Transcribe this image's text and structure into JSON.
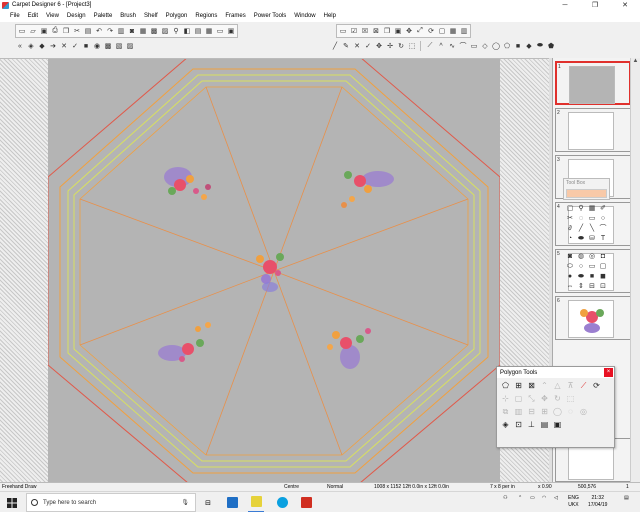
{
  "window": {
    "title": "Carpet Designer 6 - [Project3]",
    "controls": [
      "─",
      "❐",
      "✕"
    ]
  },
  "menu": [
    "File",
    "Edit",
    "View",
    "Design",
    "Palette",
    "Brush",
    "Shelf",
    "Polygon",
    "Regions",
    "Frames",
    "Power Tools",
    "Window",
    "Help"
  ],
  "toolbar": {
    "row1_icons": [
      "new-icon",
      "open-icon",
      "save-icon",
      "print-icon",
      "undo-icon",
      "redo-icon",
      "zoom-icon"
    ],
    "row2_icons": [
      "shape-icon",
      "line-icon",
      "move-icon",
      "rotate-icon",
      "rectangle-icon",
      "ellipse-icon",
      "polygon-icon"
    ]
  },
  "thumbnails": [
    {
      "num": "1",
      "kind": "grey"
    },
    {
      "num": "2",
      "kind": "floral"
    },
    {
      "num": "3",
      "kind": "blank"
    },
    {
      "num": "4",
      "kind": "tools"
    },
    {
      "num": "5",
      "kind": "tools"
    },
    {
      "num": "6",
      "kind": "bouquet"
    }
  ],
  "floating_toolbar": {
    "label": "Tool Box",
    "color": "#f8c9a8"
  },
  "polygon_tools": {
    "title": "Polygon Tools",
    "close": "×"
  },
  "status": {
    "mode": "Freehand Draw",
    "position": "Centre",
    "view": "Normal",
    "size": "1008 x 1152  12ft 0.0in x 12ft 0.0in",
    "scale": "7 x 8 per in",
    "zoom": "x 0.90",
    "coords": "500,576",
    "page": "1"
  },
  "taskbar": {
    "search_placeholder": "Type here to search",
    "lang": "ENG",
    "locale": "UKX",
    "time": "21:32",
    "date": "17/04/19"
  },
  "colors": {
    "canvas_grey": "#b4b4b4",
    "outline_red": "#e05a4a",
    "outline_orange": "#f0a040",
    "outline_yellow": "#d8e060",
    "accent_red": "#e0302c"
  }
}
